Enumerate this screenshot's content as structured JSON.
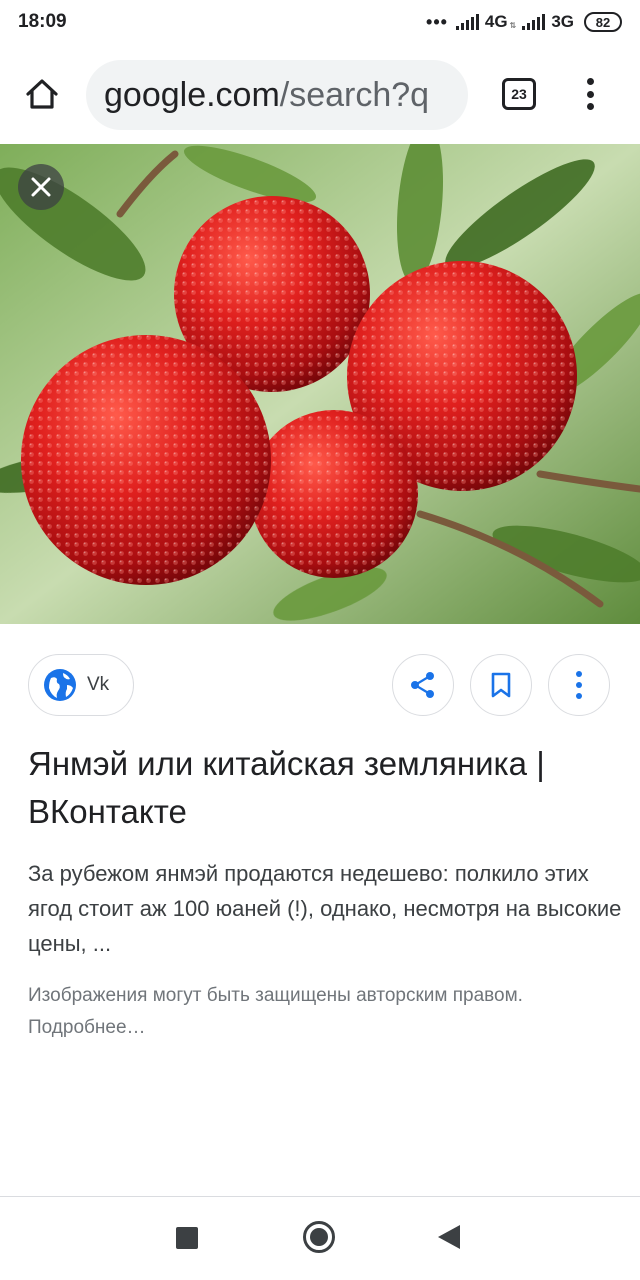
{
  "status_bar": {
    "time": "18:09",
    "dots": "•••",
    "network_1": "4G",
    "network_2": "3G",
    "battery": "82"
  },
  "browser": {
    "url_host": "google.com",
    "url_path": "/search?q",
    "tab_count": "23",
    "icons": [
      "home-icon",
      "tabs-icon",
      "overflow-menu-icon"
    ]
  },
  "image_viewer": {
    "close_icon": "close-icon",
    "image_subject": "red bayberry fruits on branch"
  },
  "result": {
    "source_label": "Vk",
    "title": "Янмэй или китайская земляника | ВКонтакте",
    "snippet": "За рубежом янмэй продаются недешево: полкило этих ягод стоит аж 100 юаней (!), однако, несмотря на высокие цены, ...",
    "copyright_notice": "Изображения могут быть защищены авторским правом. Подробнее…",
    "action_icons": [
      "share-icon",
      "bookmark-icon",
      "more-vert-icon"
    ]
  },
  "colors": {
    "accent": "#1a73e8",
    "text_primary": "#202124",
    "text_secondary": "#3c4043",
    "text_muted": "#70757a",
    "pill_bg": "#f1f3f4"
  }
}
